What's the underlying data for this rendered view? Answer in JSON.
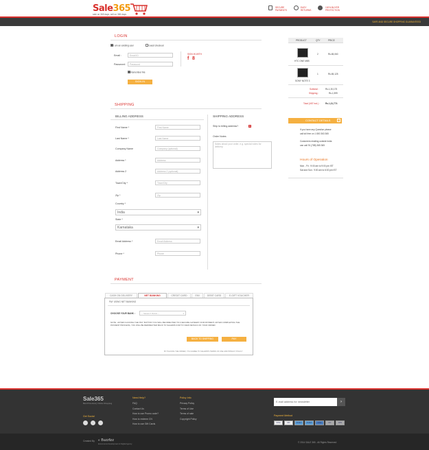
{
  "brand": {
    "logo_main": "Sale",
    "logo_num": "365",
    "tagline": "sale on 365 days, sell on 365 days"
  },
  "trust": [
    "SECURE PAYMENTS",
    "EASY RETURNS",
    "100% BUYER PROTECTION"
  ],
  "strip_text": "SAFE AND SECURE SHOPPING GUARANTEED",
  "login": {
    "title": "LOGIN",
    "existing": "I am an existing user",
    "guest": "Guest checkout",
    "email_label": "Email :",
    "email_ph": "Email ID",
    "password_label": "Password:",
    "password_ph": "Password",
    "remember": "Remember Me",
    "signin": "SIGN IN",
    "social_label": "SIGN IN WITH"
  },
  "shipping": {
    "title": "SHIPPING",
    "billing_title": "BILLING ADDRESS",
    "shipping_title": "SHIPPING ADDRESS",
    "fields": [
      {
        "label": "First Name *",
        "ph": "First Name"
      },
      {
        "label": "Last Name *",
        "ph": "Last Name"
      },
      {
        "label": "Company Name",
        "ph": "Company (optional)"
      },
      {
        "label": "Address *",
        "ph": "Address"
      },
      {
        "label": "Address 2",
        "ph": "Address 2 (optional)"
      },
      {
        "label": "Town/City *",
        "ph": "Town/City"
      },
      {
        "label": "Zip *",
        "ph": "Zip"
      }
    ],
    "country_label": "Country *",
    "country_value": "India",
    "state_label": "State *",
    "state_value": "Karnataka",
    "email_label": "Email Address *",
    "email_ph": "Email Address",
    "phone_label": "Phone *",
    "phone_ph": "Phone",
    "ship_to_billing": "Ship to billing address?",
    "order_notes": "Order Notes",
    "notes_ph": "Notes about your order, e.g. special notes for delivery."
  },
  "payment": {
    "title": "PAYMENT",
    "tabs": [
      "CASH ON DELIVERY",
      "NET BANKING",
      "CREDIT CARD",
      "EMI",
      "DEBIT CARD",
      "E-GIFT VOUCHER"
    ],
    "heading": "PAY USING NET BANKING",
    "choose": "CHOOSE YOUR BANK :",
    "select": "-- SELECT BANK --",
    "note": "NOTE : AFTER CLICKING THE 'PAY' BUTTON YOU WILL BE DIRECTED TO A SECURE GATEWAY FOR PAYMENT. AFTER COMPLETING THE PAYMENT PROCESS, YOU WILL BE REDIRECTED BACK TO SALE365.COM TO VIEW DETAILS OF YOUR ORDER.",
    "back": "BACK TO SHIPPING",
    "pay": "PAY",
    "terms": "BY PLACING THE ORDER, YOU AGREE TO SALE365'S TERMS OF USE AND PRIVACY POLICY"
  },
  "order": {
    "headers": [
      "PRODUCT",
      "QTY",
      "PRICE"
    ],
    "items": [
      {
        "name": "HTC ONE M8S",
        "qty": "2",
        "price": "Rs.65,060"
      },
      {
        "name": "SONY NOTE 3",
        "qty": "1",
        "price": "Rs.65,125"
      }
    ],
    "subtotal_label": "Subtotal :",
    "subtotal": "Rs.1,30,175",
    "shipping_label": "Shipping :",
    "shipping": "Rs.1,599",
    "total_label": "Total (VAT incl.) :",
    "total": "Rs.1,31,774"
  },
  "contact": {
    "title": "CONTACT DETAILS",
    "l1": "If you have any Question please",
    "l2": "call toll free on 1 800 363 365",
    "l3": "Customers residing outside India",
    "l4": "can call 91 (788) 365 365",
    "hours_title": "Hours of Operation",
    "h1": "Mon - Fri : 9:00 am to 9:00 pm IST",
    "h2": "Sat and Sun : 9:00 am to 6:00 pm IST"
  },
  "footer": {
    "logo": "Sale365",
    "logo_tag": "Best Price Every Online Shopping",
    "get_social": "Get Social",
    "need_help": "Need Help?",
    "help_links": [
      "FAQ",
      "Contact Us",
      "How to use Promo code?",
      "How to redeem CN",
      "How to use Gift Cards"
    ],
    "policy_info": "Policy Info",
    "policy_links": [
      "Privacy Policy",
      "Terms of Use",
      "Terms of sale",
      "Copyright Policy"
    ],
    "newsletter_ph": "E-mail address for newsletter",
    "payment_method": "Payment Method",
    "pay_icons": [
      "VISA",
      "MC",
      "AMEX",
      "AMEX",
      "MAE",
      "DC",
      "DIN"
    ],
    "created_by": "Created By",
    "creator": "Buzzfizz",
    "creator_sub": "Ecommerce Development & Digital Agency",
    "copyright": "© 2014 SALE 365 - All Rights Reserved"
  },
  "colors": {
    "brand": "#d9302c",
    "accent": "#f5b041"
  }
}
